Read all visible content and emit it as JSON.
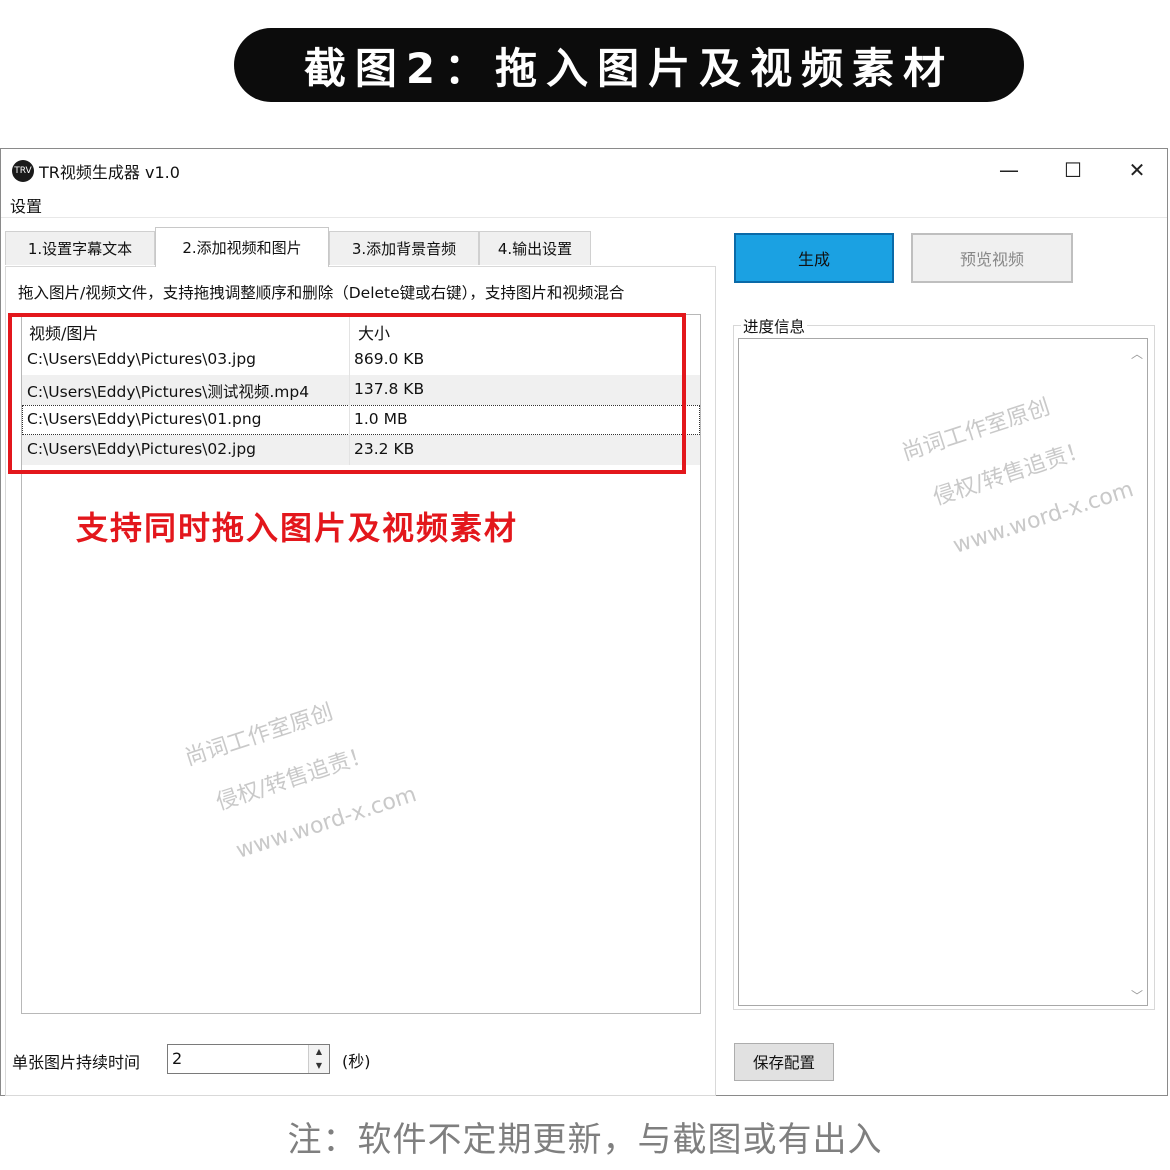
{
  "banner": {
    "title": "截图2：拖入图片及视频素材"
  },
  "window": {
    "title": "TR视频生成器 v1.0",
    "icon_text": "TRV",
    "controls": {
      "minimize": "—",
      "maximize": "☐",
      "close": "✕"
    },
    "menu": [
      "设置"
    ]
  },
  "tabs": [
    {
      "label": "1.设置字幕文本"
    },
    {
      "label": "2.添加视频和图片"
    },
    {
      "label": "3.添加背景音频"
    },
    {
      "label": "4.输出设置"
    }
  ],
  "panel": {
    "hint": "拖入图片/视频文件，支持拖拽调整顺序和删除（Delete键或右键），支持图片和视频混合",
    "columns": {
      "path": "视频/图片",
      "size": "大小"
    },
    "rows": [
      {
        "path": "C:\\Users\\Eddy\\Pictures\\03.jpg",
        "size": "869.0 KB"
      },
      {
        "path": "C:\\Users\\Eddy\\Pictures\\测试视频.mp4",
        "size": "137.8 KB"
      },
      {
        "path": "C:\\Users\\Eddy\\Pictures\\01.png",
        "size": "1.0 MB"
      },
      {
        "path": "C:\\Users\\Eddy\\Pictures\\02.jpg",
        "size": "23.2 KB"
      }
    ],
    "annotation": "支持同时拖入图片及视频素材",
    "duration_label": "单张图片持续时间",
    "duration_value": "2",
    "duration_unit": "(秒)"
  },
  "right": {
    "generate_label": "生成",
    "preview_label": "预览视频",
    "progress_label": "进度信息",
    "save_label": "保存配置"
  },
  "watermark": {
    "line1": "尚词工作室原创",
    "line2": "侵权/转售追责！",
    "line3": "www.word-x.com"
  },
  "footer": {
    "note": "注：软件不定期更新，与截图或有出入"
  },
  "colors": {
    "accent_blue": "#1ba1e2",
    "annotation_red": "#e3171c"
  }
}
